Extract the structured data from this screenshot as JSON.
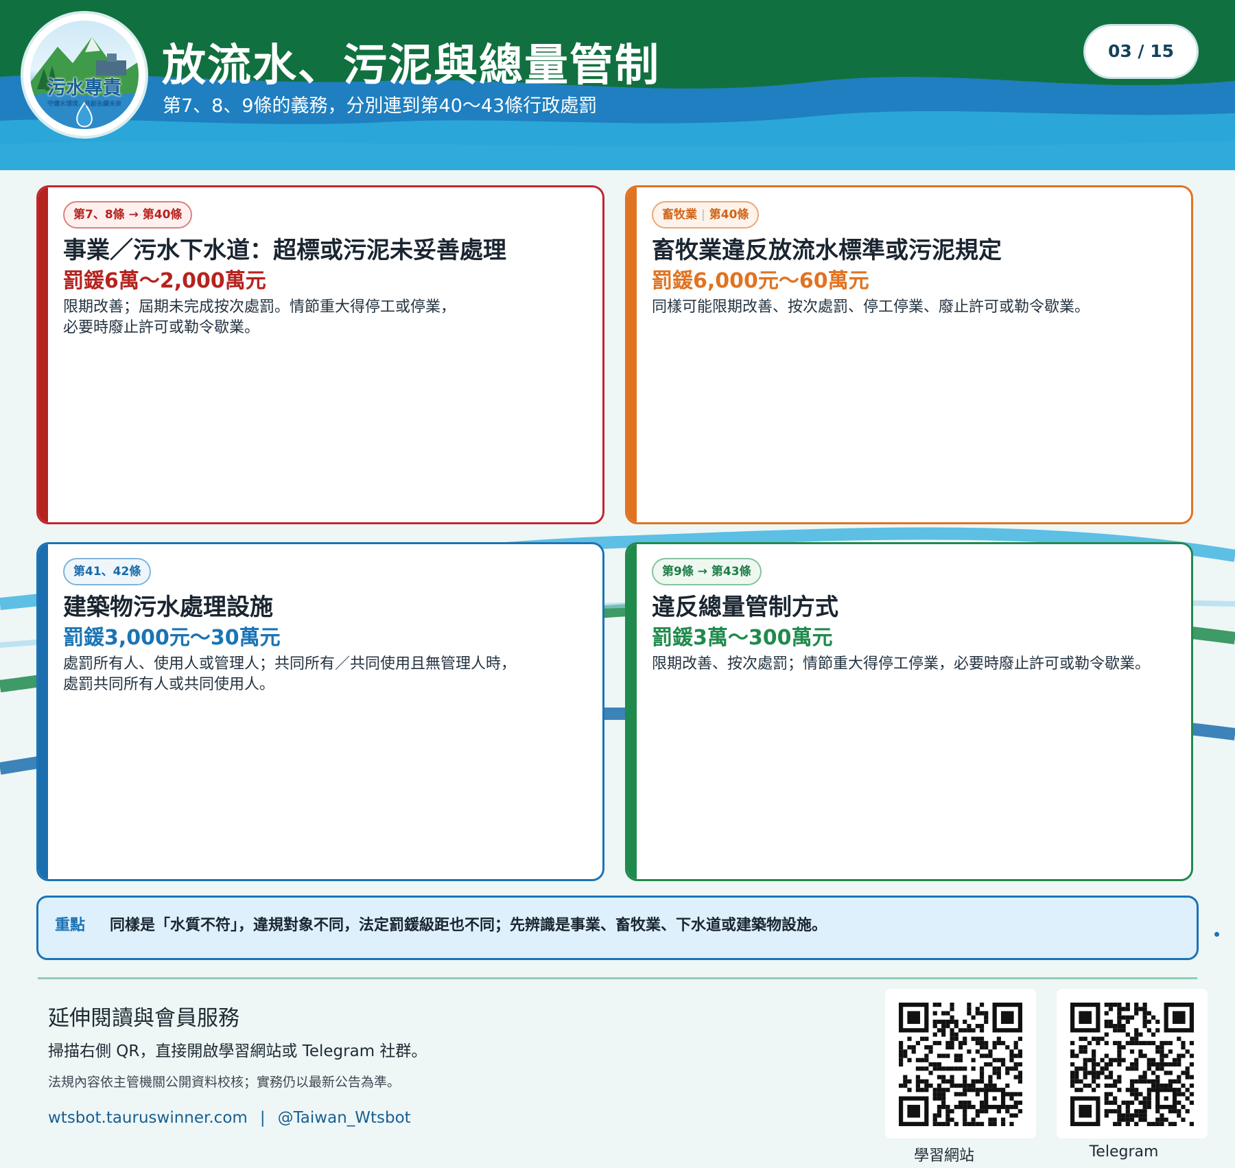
{
  "header": {
    "title": "放流水、污泥與總量管制",
    "subtitle": "第7、8、9條的義務，分別連到第40～43條行政處罰",
    "page_indicator": "03 / 15",
    "logo": {
      "title": "污水專責",
      "tagline": "守護水環境．共創永續未來"
    }
  },
  "cards": [
    {
      "tag": "第7、8條 → 第40條",
      "title": "事業／污水下水道：超標或污泥未妥善處理",
      "fine": "罰鍰6萬～2,000萬元",
      "desc_lines": [
        "限期改善；屆期未完成按次處罰。情節重大得停工或停業，",
        "必要時廢止許可或勒令歇業。"
      ],
      "color": "#c0272d"
    },
    {
      "tag_parts": [
        "畜牧業",
        "第40條"
      ],
      "title": "畜牧業違反放流水標準或污泥規定",
      "fine": "罰鍰6,000元～60萬元",
      "desc_lines": [
        "同樣可能限期改善、按次處罰、停工停業、廢止許可或勒令歇業。"
      ],
      "color": "#e07321"
    },
    {
      "tag": "第41、42條",
      "title": "建築物污水處理設施",
      "fine": "罰鍰3,000元～30萬元",
      "desc_lines": [
        "處罰所有人、使用人或管理人；共同所有／共同使用且無管理人時，",
        "處罰共同所有人或共同使用人。"
      ],
      "color": "#1a74b5"
    },
    {
      "tag": "第9條 → 第43條",
      "title": "違反總量管制方式",
      "fine": "罰鍰3萬～300萬元",
      "desc_lines": [
        "限期改善、按次處罰；情節重大得停工停業，必要時廢止許可或勒令歇業。"
      ],
      "color": "#1f8a4c"
    }
  ],
  "key_point": {
    "label": "重點",
    "text": "同樣是「水質不符」，違規對象不同，法定罰鍰級距也不同；先辨識是事業、畜牧業、下水道或建築物設施。"
  },
  "footer": {
    "title": "延伸閱讀與會員服務",
    "line1": "掃描右側 QR，直接開啟學習網站或 Telegram 社群。",
    "line2": "法規內容依主管機關公開資料校核；實務仍以最新公告為準。",
    "website": "wtsbot.tauruswinner.com",
    "separator": "|",
    "telegram_handle": "@Taiwan_Wtsbot",
    "qr_codes": [
      {
        "label": "學習網站",
        "icon": "qr-code-icon"
      },
      {
        "label": "Telegram",
        "icon": "qr-code-icon"
      }
    ]
  },
  "colors": {
    "header_green": "#13703f",
    "header_blue": "#1a8bc8",
    "accent_red": "#c0272d",
    "accent_orange": "#e07321",
    "accent_blue": "#1a74b5",
    "accent_green": "#1f8a4c"
  }
}
